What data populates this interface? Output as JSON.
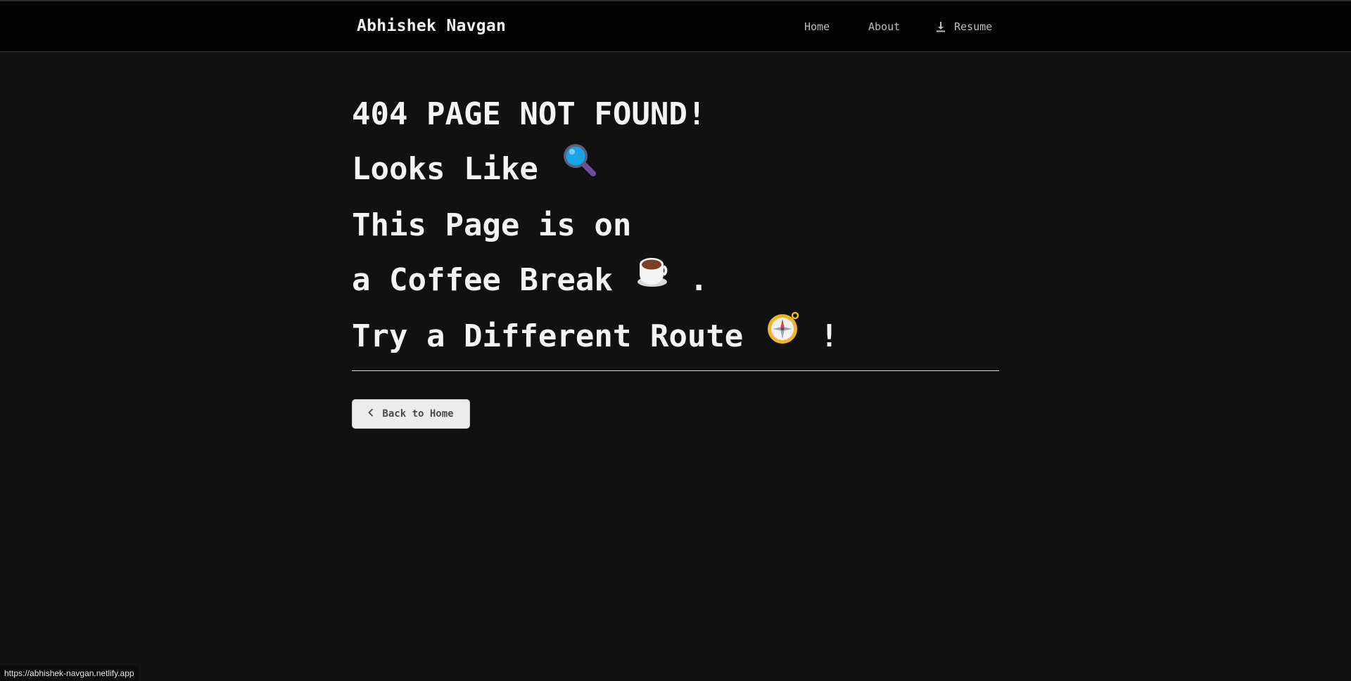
{
  "header": {
    "brand": "Abhishek Navgan",
    "nav": {
      "home": "Home",
      "about": "About",
      "resume": "Resume"
    }
  },
  "main": {
    "line1": "404 PAGE NOT FOUND!",
    "line2": "Looks Like",
    "line3": "This Page is on",
    "line4": "a Coffee Break",
    "line4_end": ".",
    "line5": "Try a Different Route",
    "line5_end": "!",
    "back_button": "Back to Home"
  },
  "status_bar": {
    "url": "https://abhishek-navgan.netlify.app"
  },
  "icons": {
    "magnifier": "magnifying-glass-icon",
    "coffee": "coffee-cup-icon",
    "compass": "compass-icon",
    "download": "download-icon",
    "back": "chevron-left-icon"
  },
  "colors": {
    "background": "#111111",
    "header_bg": "#030303",
    "text": "#f4f4f4",
    "button_bg": "#ececec"
  }
}
